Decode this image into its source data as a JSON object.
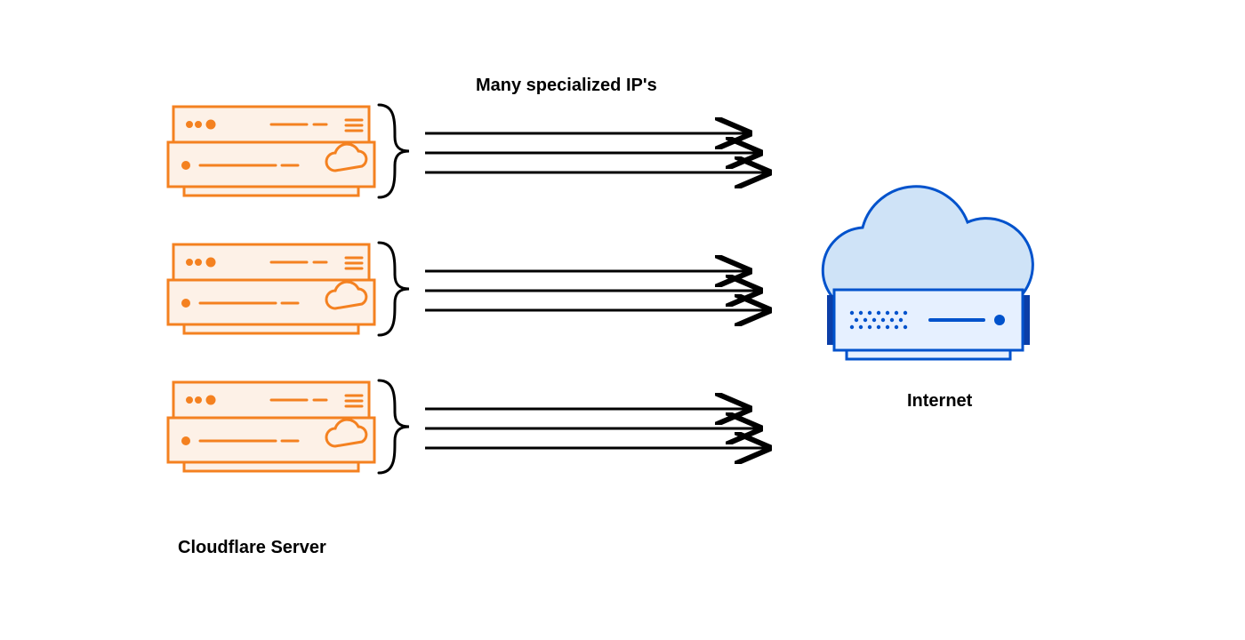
{
  "labels": {
    "top": "Many specialized IP's",
    "left_bottom": "Cloudflare Server",
    "right": "Internet"
  },
  "colors": {
    "orange": "#f48120",
    "orange_fill": "#fdf1e7",
    "blue": "#0052cc",
    "blue_dark": "#0b3ea8",
    "blue_fill": "#e6f0ff",
    "cloud_fill": "#cfe3f7",
    "black": "#000000"
  },
  "diagram": {
    "type": "network-architecture",
    "left_entity": "Cloudflare Server",
    "left_count": 3,
    "arrows_per_server": 3,
    "arrow_label": "Many specialized IP's",
    "right_entity": "Internet",
    "direction": "left-to-right"
  }
}
